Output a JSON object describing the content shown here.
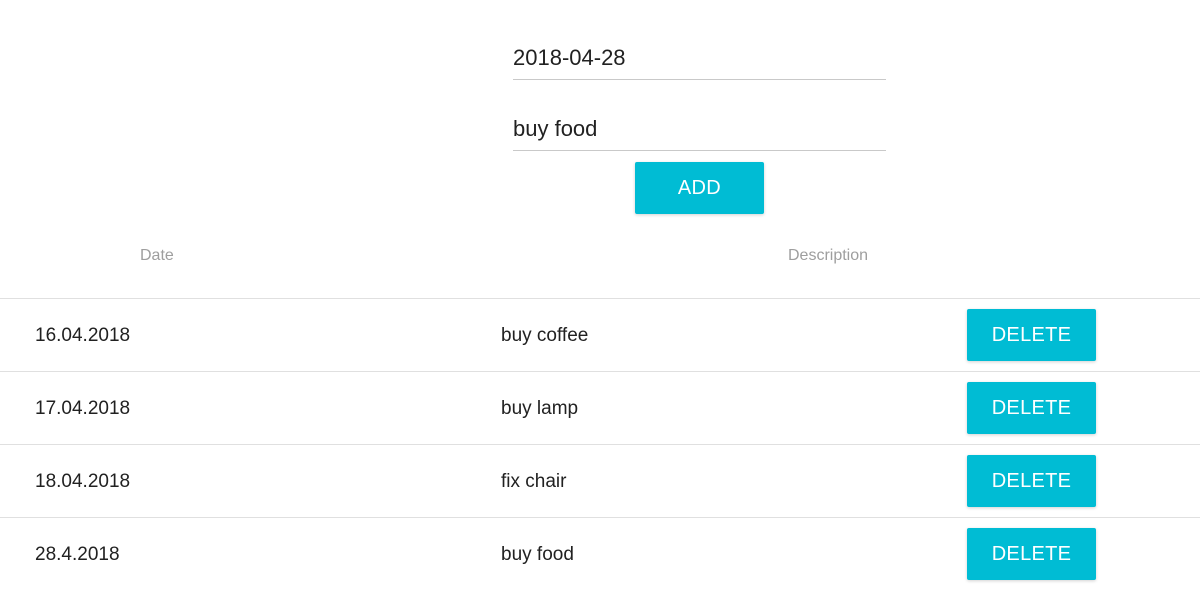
{
  "form": {
    "date_value": "2018-04-28",
    "description_value": "buy food",
    "add_label": "ADD"
  },
  "table": {
    "headers": {
      "date": "Date",
      "description": "Description"
    },
    "rows": [
      {
        "date": "16.04.2018",
        "description": "buy coffee",
        "delete_label": "DELETE"
      },
      {
        "date": "17.04.2018",
        "description": "buy lamp",
        "delete_label": "DELETE"
      },
      {
        "date": "18.04.2018",
        "description": "fix chair",
        "delete_label": "DELETE"
      },
      {
        "date": "28.4.2018",
        "description": "buy food",
        "delete_label": "DELETE"
      }
    ]
  },
  "colors": {
    "accent": "#00bcd4",
    "text": "#212121",
    "header_text": "#9e9e9e",
    "divider": "#e0e0e0"
  }
}
